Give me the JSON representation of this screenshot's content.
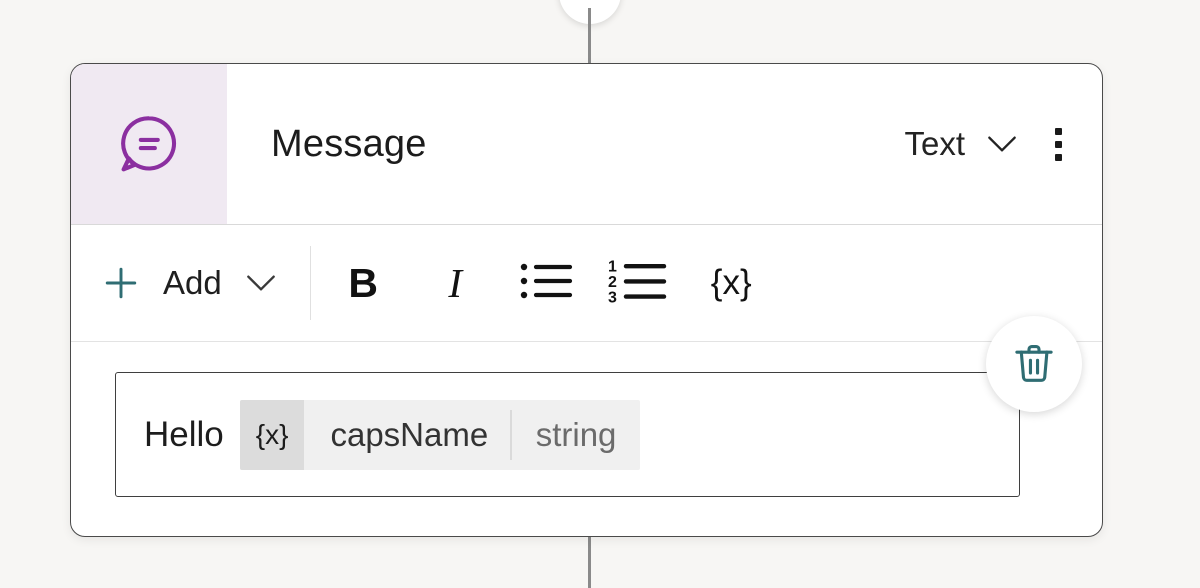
{
  "canvas": {
    "background_color": "#f7f6f4",
    "connector_color": "#8a8a8a"
  },
  "node": {
    "icon": "message-bubble-icon",
    "icon_panel_color": "#f0e9f2",
    "icon_color": "#8b2fa0",
    "title": "Message",
    "type_selector": {
      "value": "Text",
      "chevron": "chevron-down-icon"
    },
    "overflow_menu": "kebab-menu-icon"
  },
  "toolbar": {
    "add": {
      "label": "Add",
      "plus_icon": "plus-icon",
      "plus_color": "#2f6d73",
      "chevron": "chevron-down-icon"
    },
    "buttons": [
      {
        "name": "bold",
        "glyph": "B"
      },
      {
        "name": "italic",
        "glyph": "I"
      },
      {
        "name": "bulleted-list",
        "glyph": "bulleted-list-icon"
      },
      {
        "name": "numbered-list",
        "glyph": "numbered-list-icon",
        "digits": [
          "1",
          "2",
          "3"
        ]
      },
      {
        "name": "variable",
        "glyph": "{x}"
      }
    ]
  },
  "message_input": {
    "text_before": "Hello",
    "token": {
      "sigil": "{x}",
      "name": "capsName",
      "type": "string"
    }
  },
  "delete_button": {
    "icon": "trash-icon",
    "icon_color": "#2f6d73"
  }
}
